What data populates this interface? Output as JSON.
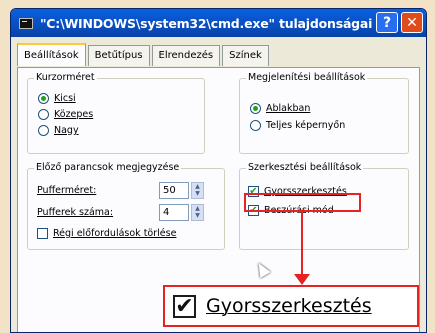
{
  "window": {
    "title": "\"C:\\WINDOWS\\system32\\cmd.exe\" tulajdonságai",
    "help_label": "?",
    "close_label": "✕"
  },
  "tabs": [
    {
      "label": "Beállítások",
      "active": true
    },
    {
      "label": "Betűtípus",
      "active": false
    },
    {
      "label": "Elrendezés",
      "active": false
    },
    {
      "label": "Színek",
      "active": false
    }
  ],
  "cursor_group": {
    "title": "Kurzorméret",
    "options": [
      {
        "label": "Kicsi",
        "checked": true
      },
      {
        "label": "Közepes",
        "checked": false
      },
      {
        "label": "Nagy",
        "checked": false
      }
    ]
  },
  "display_group": {
    "title": "Megjelenítési beállítások",
    "options": [
      {
        "label": "Ablakban",
        "checked": true
      },
      {
        "label": "Teljes képernyőn",
        "checked": false
      }
    ]
  },
  "history_group": {
    "title": "Előző parancsok megjegyzése",
    "buffer_size_label": "Pufferméret:",
    "buffer_size_value": "50",
    "buffer_count_label": "Pufferek száma:",
    "buffer_count_value": "4",
    "discard_old_label": "Régi előfordulások törlése",
    "discard_old_checked": false
  },
  "edit_group": {
    "title": "Szerkesztési beállítások",
    "quick_edit_label": "Gyorsszerkesztés",
    "quick_edit_checked": true,
    "insert_mode_label": "Beszúrási mód",
    "insert_mode_checked": true
  },
  "callout": {
    "label": "Gyorsszerkesztés",
    "check_mark": "✔"
  },
  "colors": {
    "title_bar": "#0a5fe0",
    "close_button": "#e04b1c",
    "highlight": "#e62222",
    "background": "#f3e3c6"
  }
}
